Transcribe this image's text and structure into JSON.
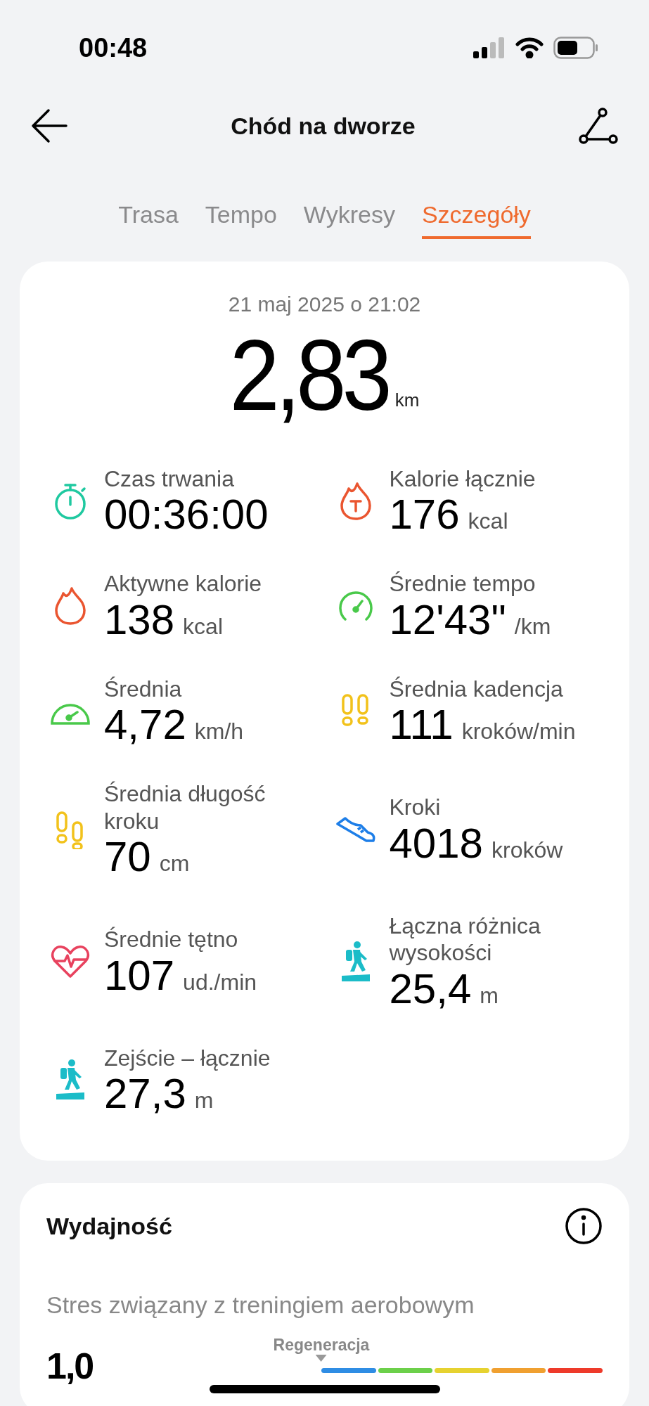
{
  "status_bar": {
    "time": "00:48"
  },
  "header": {
    "title": "Chód na dworze"
  },
  "tabs": [
    {
      "label": "Trasa",
      "selected": false
    },
    {
      "label": "Tempo",
      "selected": false
    },
    {
      "label": "Wykresy",
      "selected": false
    },
    {
      "label": "Szczegóły",
      "selected": true
    }
  ],
  "summary": {
    "date": "21 maj 2025 o 21:02",
    "distance": "2,83",
    "distance_unit": "km"
  },
  "stats": [
    {
      "kind": "stopwatch",
      "label": "Czas trwania",
      "value": "00:36:00"
    },
    {
      "kind": "total_calories",
      "label": "Kalorie łącznie",
      "value": "176",
      "unit": "kcal"
    },
    {
      "kind": "active_calories",
      "label": "Aktywne kalorie",
      "value": "138",
      "unit": "kcal"
    },
    {
      "kind": "pace",
      "label": "Średnie tempo",
      "value": "12'43\"",
      "unit": "/km"
    },
    {
      "kind": "speed",
      "label": "Średnia",
      "value": "4,72",
      "unit": "km/h"
    },
    {
      "kind": "cadence",
      "label": "Średnia kadencja",
      "value": "111",
      "unit": "kroków/min"
    },
    {
      "kind": "stride",
      "label": "Średnia długość kroku",
      "value": "70",
      "unit": "cm"
    },
    {
      "kind": "steps",
      "label": "Kroki",
      "value": "4018",
      "unit": "kroków"
    },
    {
      "kind": "heart",
      "label": "Średnie tętno",
      "value": "107",
      "unit": "ud./min"
    },
    {
      "kind": "ascent",
      "label": "Łączna różnica wysokości",
      "value": "25,4",
      "unit": "m"
    },
    {
      "kind": "descent",
      "label": "Zejście – łącznie",
      "value": "27,3",
      "unit": "m"
    }
  ],
  "performance": {
    "title": "Wydajność",
    "subtitle": "Stres związany z treningiem aerobowym",
    "value": "1,0",
    "marker_label": "Regeneracja",
    "segments": [
      {
        "color": "#2f8de4"
      },
      {
        "color": "#6cd04a"
      },
      {
        "color": "#e6d230"
      },
      {
        "color": "#f0a030"
      },
      {
        "color": "#ee3a2a"
      }
    ]
  }
}
